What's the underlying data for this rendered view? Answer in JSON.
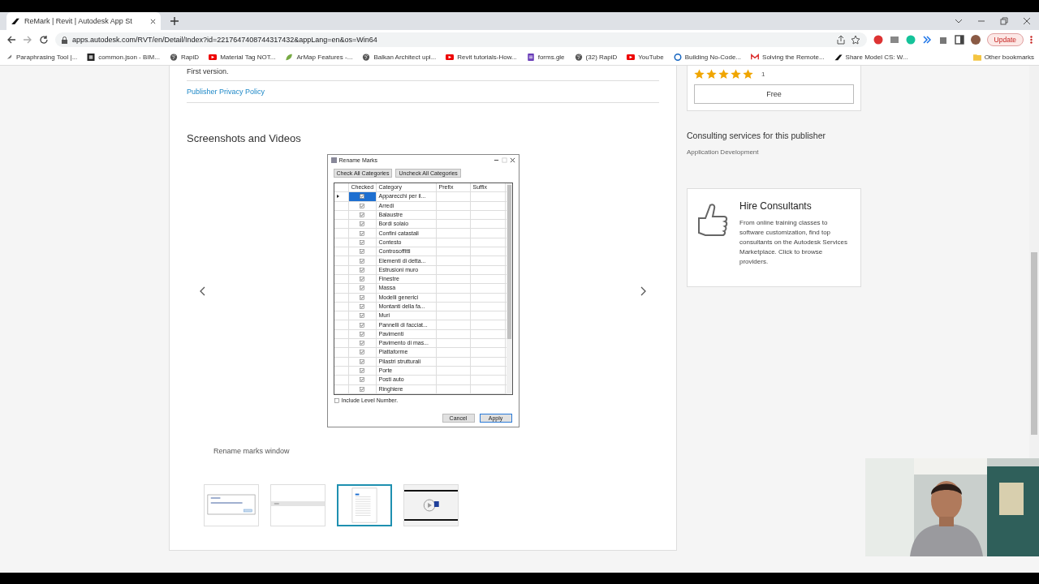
{
  "browser": {
    "tab": {
      "title": "ReMark | Revit | Autodesk App St"
    },
    "url": "apps.autodesk.com/RVT/en/Detail/Index?id=2217647408744317432&appLang=en&os=Win64",
    "bookmarks": [
      {
        "label": "Paraphrasing Tool |...",
        "kind": "feather"
      },
      {
        "label": "common.json - BIM...",
        "kind": "square"
      },
      {
        "label": "RapiD",
        "kind": "globe"
      },
      {
        "label": "Material Tag NOT...",
        "kind": "youtube"
      },
      {
        "label": "ArMap Features -...",
        "kind": "leaf"
      },
      {
        "label": "Balkan Architect upl...",
        "kind": "globe"
      },
      {
        "label": "Revit tutorials-How...",
        "kind": "youtube"
      },
      {
        "label": "forms.gle",
        "kind": "forms"
      },
      {
        "label": "(32) RapiD",
        "kind": "globe"
      },
      {
        "label": "YouTube",
        "kind": "youtube"
      },
      {
        "label": "Building No-Code...",
        "kind": "c"
      },
      {
        "label": "Solving the Remote...",
        "kind": "gmail"
      },
      {
        "label": "Share Model CS: W...",
        "kind": "autodesk"
      }
    ],
    "other_bookmarks": "Other bookmarks",
    "update_button": "Update"
  },
  "main": {
    "release_note": "First version.",
    "privacy_link": "Publisher Privacy Policy",
    "section_title": "Screenshots and Videos",
    "dialog": {
      "title": "Rename Marks",
      "top_buttons": [
        "Check All Categories",
        "Uncheck All Categories"
      ],
      "columns": [
        "Checked",
        "Category",
        "Prefix",
        "Suffix"
      ],
      "rows": [
        {
          "category": "Apparecchi per il...",
          "checked": true,
          "selected": true
        },
        {
          "category": "Arredi",
          "checked": true,
          "selected": false
        },
        {
          "category": "Balaustre",
          "checked": true,
          "selected": false
        },
        {
          "category": "Bordi solaio",
          "checked": true,
          "selected": false
        },
        {
          "category": "Confini catastali",
          "checked": true,
          "selected": false
        },
        {
          "category": "Contesto",
          "checked": true,
          "selected": false
        },
        {
          "category": "Controsoffitti",
          "checked": true,
          "selected": false
        },
        {
          "category": "Elementi di detta...",
          "checked": true,
          "selected": false
        },
        {
          "category": "Estrusioni muro",
          "checked": true,
          "selected": false
        },
        {
          "category": "Finestre",
          "checked": true,
          "selected": false
        },
        {
          "category": "Massa",
          "checked": true,
          "selected": false
        },
        {
          "category": "Modelli generici",
          "checked": true,
          "selected": false
        },
        {
          "category": "Montanti della fa...",
          "checked": true,
          "selected": false
        },
        {
          "category": "Muri",
          "checked": true,
          "selected": false
        },
        {
          "category": "Pannelli di facciat...",
          "checked": true,
          "selected": false
        },
        {
          "category": "Pavimenti",
          "checked": true,
          "selected": false
        },
        {
          "category": "Pavimento di mas...",
          "checked": true,
          "selected": false
        },
        {
          "category": "Piattaforme",
          "checked": true,
          "selected": false
        },
        {
          "category": "Pilastri strutturali",
          "checked": true,
          "selected": false
        },
        {
          "category": "Porte",
          "checked": true,
          "selected": false
        },
        {
          "category": "Posti auto",
          "checked": true,
          "selected": false
        },
        {
          "category": "Ringhiere",
          "checked": true,
          "selected": false
        }
      ],
      "include_level": {
        "label": "Include Level Number.",
        "checked": false
      },
      "buttons": [
        "Cancel",
        "Apply"
      ]
    },
    "caption": "Rename marks window",
    "thumbnails": [
      {
        "kind": "message",
        "selected": false
      },
      {
        "kind": "blank",
        "selected": false
      },
      {
        "kind": "dialog",
        "selected": true
      },
      {
        "kind": "video",
        "selected": false
      }
    ]
  },
  "side": {
    "stars": 5,
    "review_count": "1",
    "price_button": "Free",
    "consulting_title": "Consulting services for this publisher",
    "consulting_item": "Application Development",
    "hire": {
      "title": "Hire Consultants",
      "text": "From online training classes to software customization, find top consultants on the Autodesk Services Marketplace. Click to browse providers."
    }
  }
}
